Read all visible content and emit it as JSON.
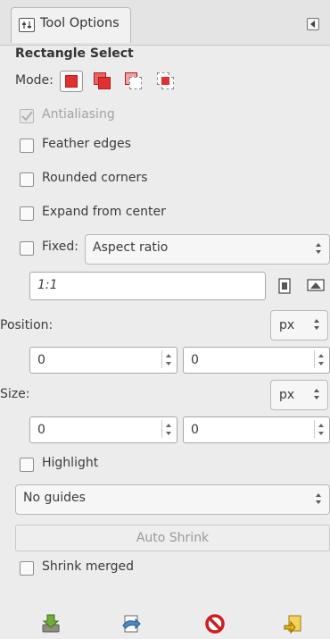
{
  "tab": {
    "label": "Tool Options",
    "icon": "tool-options-icon"
  },
  "tool_title": "Rectangle Select",
  "mode": {
    "label": "Mode:",
    "buttons": [
      {
        "name": "replace-mode-icon",
        "active": true
      },
      {
        "name": "add-mode-icon",
        "active": false
      },
      {
        "name": "subtract-mode-icon",
        "active": false
      },
      {
        "name": "intersect-mode-icon",
        "active": false
      }
    ]
  },
  "options": {
    "antialiasing": {
      "label": "Antialiasing",
      "checked": true,
      "disabled": true
    },
    "feather_edges": {
      "label": "Feather edges",
      "checked": false
    },
    "rounded_corners": {
      "label": "Rounded corners",
      "checked": false
    },
    "expand_from_center": {
      "label": "Expand from center",
      "checked": false
    },
    "fixed": {
      "label": "Fixed:",
      "checked": false,
      "value": "Aspect ratio"
    },
    "ratio_value": "1:1",
    "highlight": {
      "label": "Highlight",
      "checked": false
    },
    "shrink_merged": {
      "label": "Shrink merged",
      "checked": false
    }
  },
  "position": {
    "label": "Position:",
    "unit": "px",
    "x": "0",
    "y": "0"
  },
  "size": {
    "label": "Size:",
    "unit": "px",
    "w": "0",
    "h": "0"
  },
  "guides": {
    "value": "No guides"
  },
  "auto_shrink_label": "Auto Shrink",
  "bottom_icons": [
    "save-preset-icon",
    "restore-preset-icon",
    "delete-preset-icon",
    "reset-icon"
  ],
  "colors": {
    "accent": "#e03030",
    "background": "#ececec"
  }
}
